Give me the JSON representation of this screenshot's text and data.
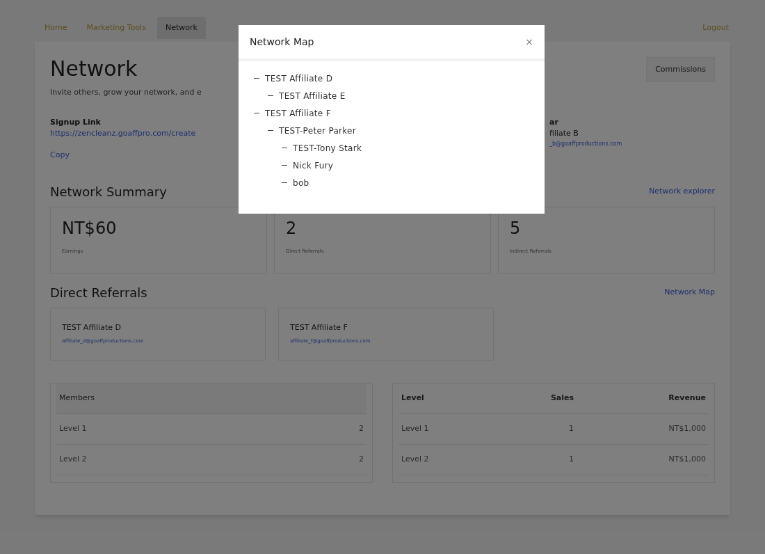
{
  "nav": {
    "tabs": [
      {
        "label": "Home",
        "selected": false
      },
      {
        "label": "Marketing Tools",
        "selected": false
      },
      {
        "label": "Network",
        "selected": true
      }
    ],
    "logout": "Logout"
  },
  "header": {
    "title": "Network",
    "subtitle": "Invite others, grow your network, and e",
    "commissions": "Commissions"
  },
  "signup": {
    "label": "Signup Link",
    "url": "https://zencleanz.goaffpro.com/create",
    "copy": "Copy"
  },
  "sponsor": {
    "heading": "ar",
    "name": "filiate B",
    "email": "_b@goaffproductions.com"
  },
  "summary": {
    "title": "Network Summary",
    "link": "Network explorer",
    "stats": [
      {
        "value": "NT$60",
        "label": "Earnings"
      },
      {
        "value": "2",
        "label": "Direct Referrals"
      },
      {
        "value": "5",
        "label": "Indirect Referrals"
      }
    ]
  },
  "referrals": {
    "title": "Direct Referrals",
    "link": "Network Map",
    "items": [
      {
        "name": "TEST Affiliate D",
        "email": "affiliate_d@goaffproductions.com"
      },
      {
        "name": "TEST Affiliate F",
        "email": "affiliate_f@goaffproductions.com"
      }
    ]
  },
  "members": {
    "heading": "Members",
    "rows": [
      {
        "level": "Level 1",
        "count": "2"
      },
      {
        "level": "Level 2",
        "count": "2"
      }
    ]
  },
  "sales": {
    "columns": [
      "Level",
      "Sales",
      "Revenue"
    ],
    "rows": [
      [
        "Level 1",
        "1",
        "NT$1,000"
      ],
      [
        "Level 2",
        "1",
        "NT$1,000"
      ]
    ]
  },
  "modal": {
    "title": "Network Map",
    "close": "×",
    "tree": [
      {
        "name": "TEST Affiliate D",
        "children": [
          {
            "name": "TEST Affiliate E"
          }
        ]
      },
      {
        "name": "TEST Affiliate F",
        "children": [
          {
            "name": "TEST-Peter Parker",
            "children": [
              {
                "name": "TEST-Tony Stark"
              },
              {
                "name": "Nick Fury"
              },
              {
                "name": "bob"
              }
            ]
          }
        ]
      }
    ]
  }
}
